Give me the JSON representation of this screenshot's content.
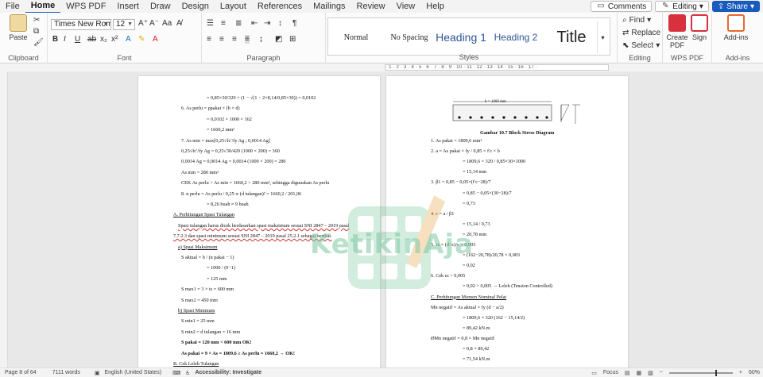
{
  "menu": {
    "tabs": [
      "File",
      "Home",
      "WPS PDF",
      "Insert",
      "Draw",
      "Design",
      "Layout",
      "References",
      "Mailings",
      "Review",
      "View",
      "Help"
    ],
    "active": "Home",
    "comments": "Comments",
    "editing": "Editing",
    "share": "Share"
  },
  "ribbon": {
    "clipboard": {
      "paste": "Paste",
      "label": "Clipboard"
    },
    "font": {
      "family": "Times New Roman",
      "size": "12",
      "label": "Font"
    },
    "paragraph": {
      "label": "Paragraph"
    },
    "styles": {
      "items": [
        "Normal",
        "No Spacing",
        "Heading 1",
        "Heading 2",
        "Title"
      ],
      "label": "Styles"
    },
    "editing": {
      "find": "Find",
      "replace": "Replace",
      "select": "Select",
      "label": "Editing"
    },
    "wps": {
      "create_pdf": "Create PDF",
      "sign": "Sign",
      "label": "WPS PDF"
    },
    "addins": {
      "button": "Add-ins",
      "label": "Add-ins"
    },
    "colors": {
      "accent": "#185abd",
      "wps_red": "#d9303e",
      "addins_orange": "#e86a2c"
    }
  },
  "ruler": {
    "marks": "· 1 · 2 · 3 · 4 · 5 · 6 · 7 · 8 · 9 · 10 · 11 · 12 · 13 · 14 · 15 · 16 · 17 ·"
  },
  "page1": {
    "lines": [
      "= 0,85×30/320 × (1 − √(1 − 2×8,14/0,85×30)) = 0,0102",
      "6.   As perlu   = ρpakai × (b × d)",
      "= 0,0102 × 1000 × 162",
      "= 1660,2 mm²",
      "7.   As min   = max[0,25√fc′/fy Ag ; 0,0014 Ag]",
      "0,25√fc′/fy Ag  = 0,25√30/420 (1000 × 200) = 360",
      "0,0014 Ag   = 0,0014 Ag = 0,0014 (1000 × 200) = 280",
      "As min   = 280 mm²",
      "CEK As perlu > As min = 1660,2 > 280 mm², sehingga digunakan As perlu",
      "8.   n perlu   = As perlu / 0,25·π·(d tulangan)² = 1660,2 / 201,06",
      "= 8,26 buah ≈ 9 buah",
      "A.  Perhitungan Spasi Tulangan",
      "Spasi tulangan harus dicek berdasarkan spasi maksimum sesuai SNI 2847 – 2019 pasal",
      "7.7.2.3 dan spasi minimum sesuai SNI 2847 – 2019 pasal 25.2.1 sebagai berikut.",
      "a)  Spasi Maksimum",
      "S aktual   = b / (n pakai − 1)",
      "= 1000 / (9−1)",
      "= 125 mm",
      "S max1   = 3 × ts = 600 mm",
      "S max2   = 450 mm",
      "b)  Spasi Minimum",
      "S min1   = 25 mm",
      "S min2   = d tulangan = 16 mm",
      "S pakai  = 120 mm < 600 mm OK!",
      "As pakai = 9 × As = 1809,6 ≥ As perlu = 1660,2 → OK!",
      "B.  Cek Leleh Tulangan"
    ]
  },
  "page2": {
    "fig_width": "b = 1000 mm",
    "caption": "Gambar 10.7 Block Stress Diagram",
    "lines": [
      "1.   As pakai   = 1809,6 mm²",
      "2.   a   = As pakai × fy / 0,85 × f′c × b",
      "= 1809,6 × 320 / 0,85×30×1000",
      "= 15,14 mm",
      "3.   β1   = 0,85 − 0,05×(f′c−28)/7",
      "= 0,85 − 0,05×(30−28)/7",
      "= 0,73",
      "4.   c   = a / β1",
      "= 15,14 / 0,73",
      "= 20,78 mm",
      "5.   εs   = (d−c)/c × 0,003",
      "= (162−20,78)/20,78 × 0,003",
      "= 0,02",
      "6.   Cek   εs > 0,005",
      "= 0,02 > 0,005 → Leleh (Tension Controlled)",
      "C.  Perhitungan Momen Nominal Pelat",
      "Mn negatif   = As aktual × fy (d − a/2)",
      "= 1809,6 × 320 (162 − 15,14/2)",
      "= 89,42 kN.m",
      "ØMn negatif   = 0,8 × Mn negatif",
      "= 0,8 × 89,42",
      "= 71,54 kN.m"
    ]
  },
  "watermark": {
    "text": "KetikinAja"
  },
  "status": {
    "page": "Page 8 of 64",
    "words": "7111 words",
    "language": "English (United States)",
    "accessibility": "Accessibility: Investigate",
    "focus": "Focus",
    "zoom": "60%"
  }
}
